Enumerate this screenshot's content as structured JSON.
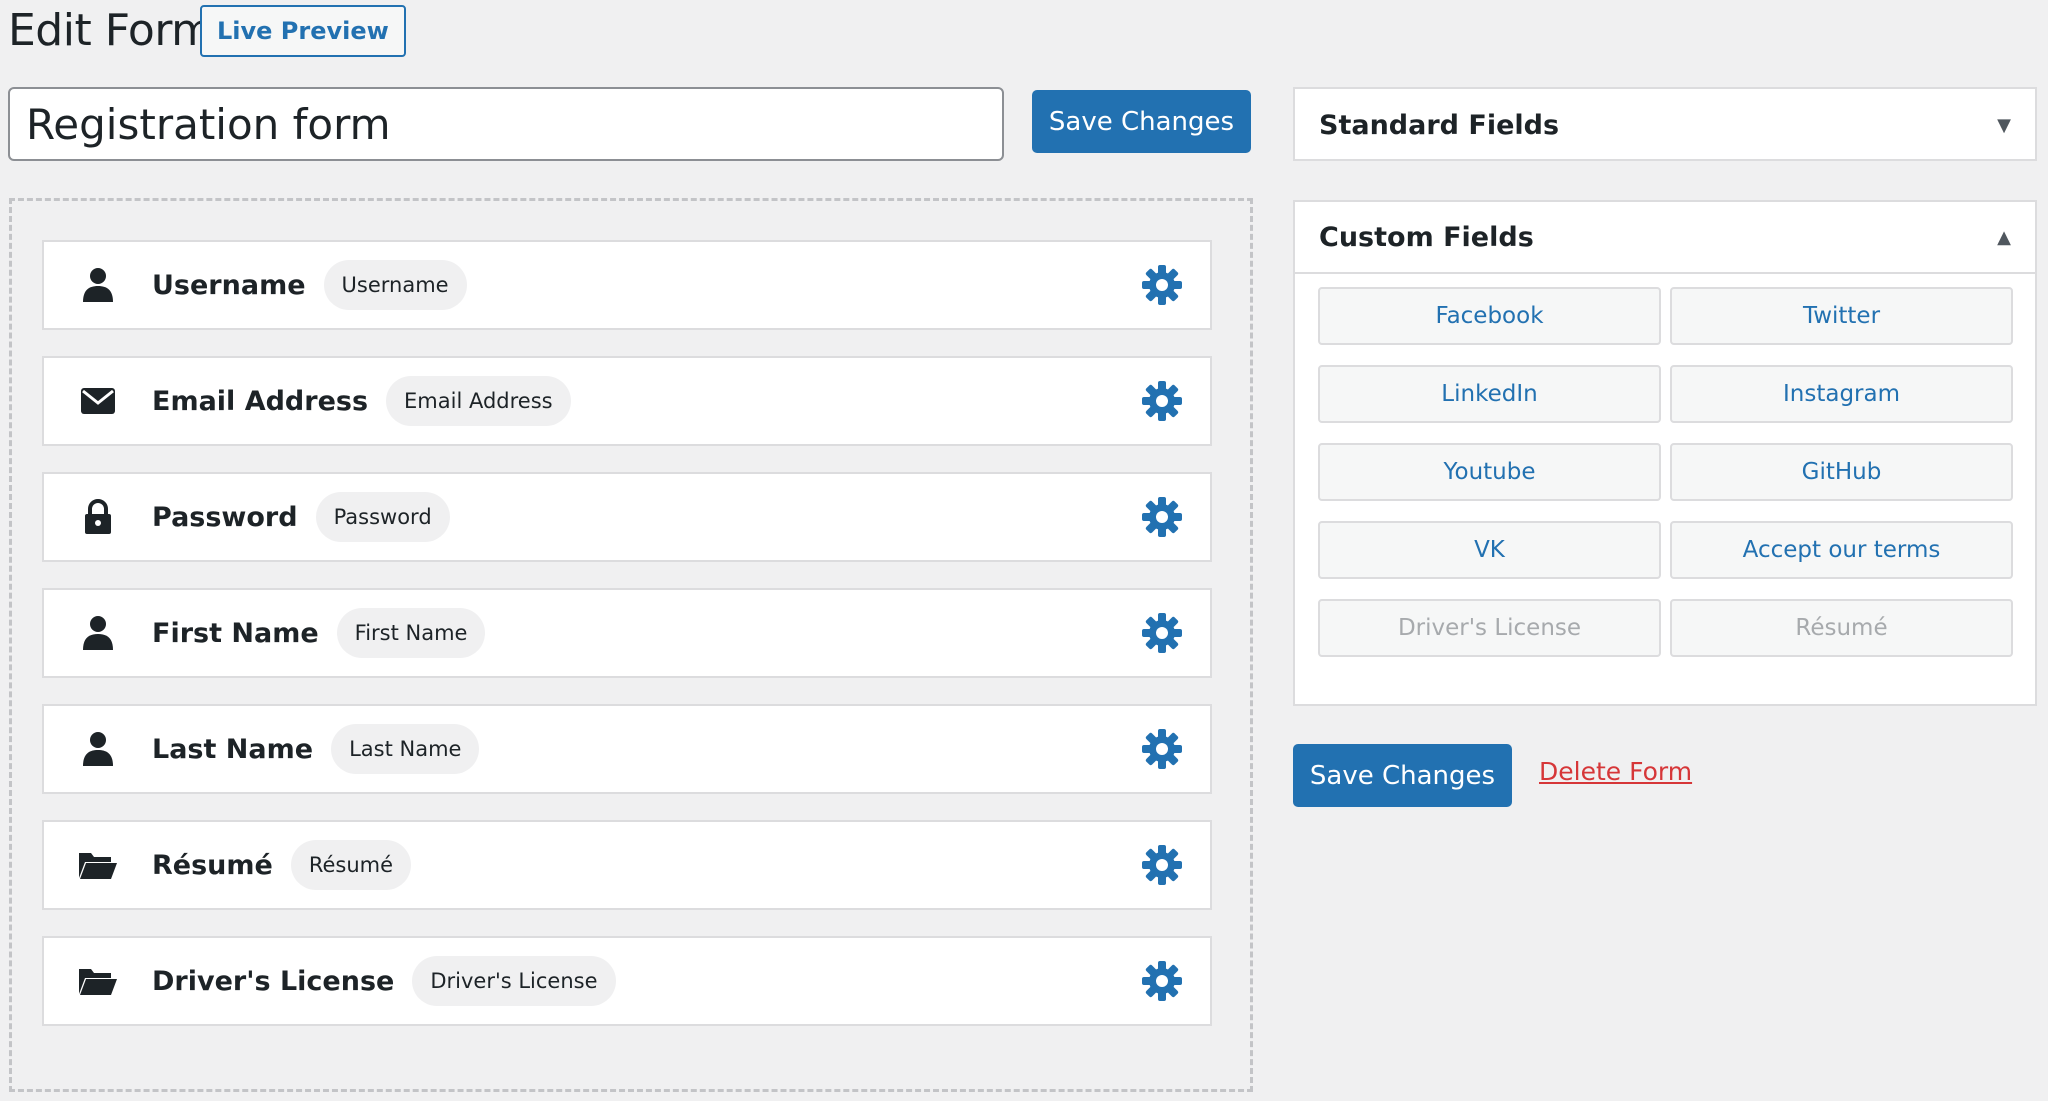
{
  "header": {
    "title": "Edit Form",
    "live_preview": "Live Preview"
  },
  "form": {
    "name_value": "Registration form",
    "save_label": "Save Changes",
    "delete_label": "Delete Form"
  },
  "fields": [
    {
      "label": "Username",
      "chip": "Username",
      "icon": "user-icon"
    },
    {
      "label": "Email Address",
      "chip": "Email Address",
      "icon": "envelope-icon"
    },
    {
      "label": "Password",
      "chip": "Password",
      "icon": "lock-icon"
    },
    {
      "label": "First Name",
      "chip": "First Name",
      "icon": "user-icon"
    },
    {
      "label": "Last Name",
      "chip": "Last Name",
      "icon": "user-icon"
    },
    {
      "label": "Résumé",
      "chip": "Résumé",
      "icon": "folder-open-icon"
    },
    {
      "label": "Driver's License",
      "chip": "Driver's License",
      "icon": "folder-open-icon"
    }
  ],
  "sidebar": {
    "standard_title": "Standard Fields",
    "standard_state": "collapsed",
    "custom_title": "Custom Fields",
    "custom_state": "expanded",
    "custom_buttons": [
      {
        "label": "Facebook",
        "enabled": true
      },
      {
        "label": "Twitter",
        "enabled": true
      },
      {
        "label": "LinkedIn",
        "enabled": true
      },
      {
        "label": "Instagram",
        "enabled": true
      },
      {
        "label": "Youtube",
        "enabled": true
      },
      {
        "label": "GitHub",
        "enabled": true
      },
      {
        "label": "VK",
        "enabled": true
      },
      {
        "label": "Accept our terms",
        "enabled": true
      },
      {
        "label": "Driver's License",
        "enabled": false
      },
      {
        "label": "Résumé",
        "enabled": false
      }
    ]
  },
  "colors": {
    "primary": "#2271b1",
    "danger": "#d63638",
    "background": "#f0f0f1"
  }
}
